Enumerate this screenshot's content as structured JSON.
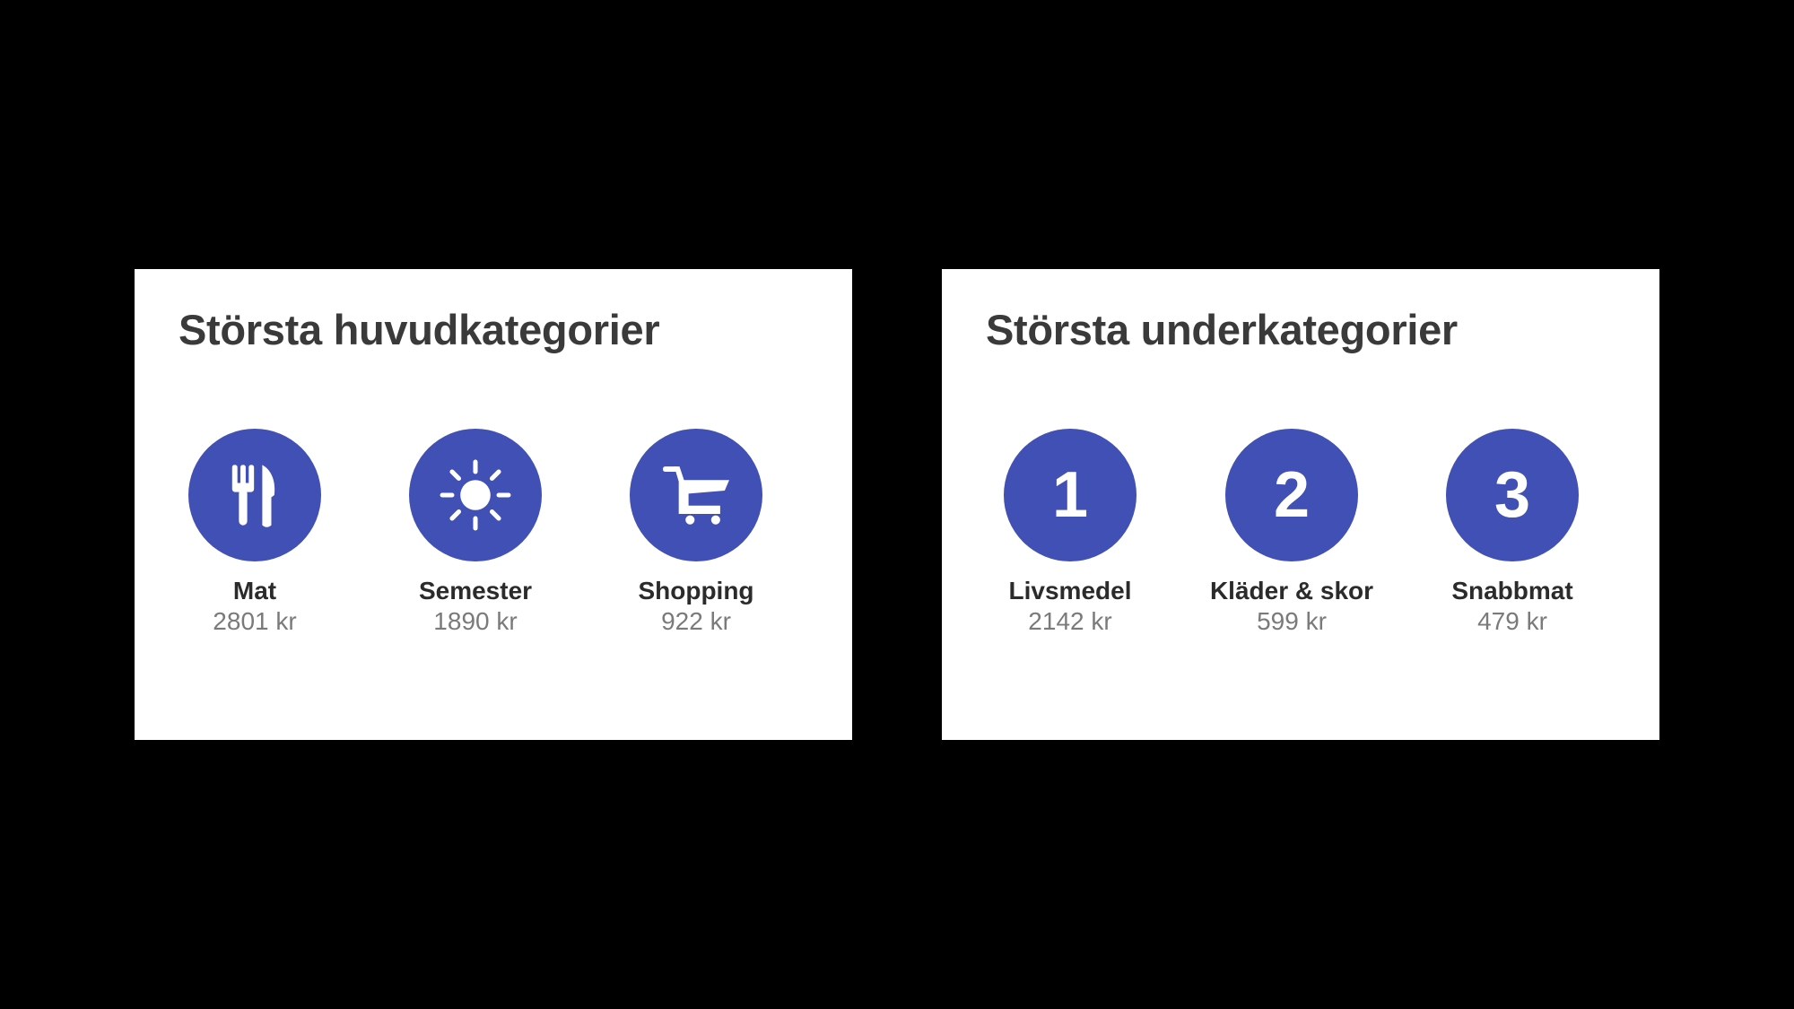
{
  "theme": {
    "accent": "#4150b5",
    "icon_color": "#ffffff",
    "card_background": "#ffffff",
    "page_background": "#000000"
  },
  "main_categories": {
    "title": "Största huvudkategorier",
    "items": [
      {
        "name": "Mat",
        "amount": "2801 kr",
        "icon": "fork-knife-icon"
      },
      {
        "name": "Semester",
        "amount": "1890 kr",
        "icon": "sun-icon"
      },
      {
        "name": "Shopping",
        "amount": "922 kr",
        "icon": "shopping-cart-icon"
      }
    ]
  },
  "sub_categories": {
    "title": "Största underkategorier",
    "items": [
      {
        "rank": "1",
        "name": "Livsmedel",
        "amount": "2142 kr"
      },
      {
        "rank": "2",
        "name": "Kläder & skor",
        "amount": "599 kr"
      },
      {
        "rank": "3",
        "name": "Snabbmat",
        "amount": "479 kr"
      }
    ]
  }
}
